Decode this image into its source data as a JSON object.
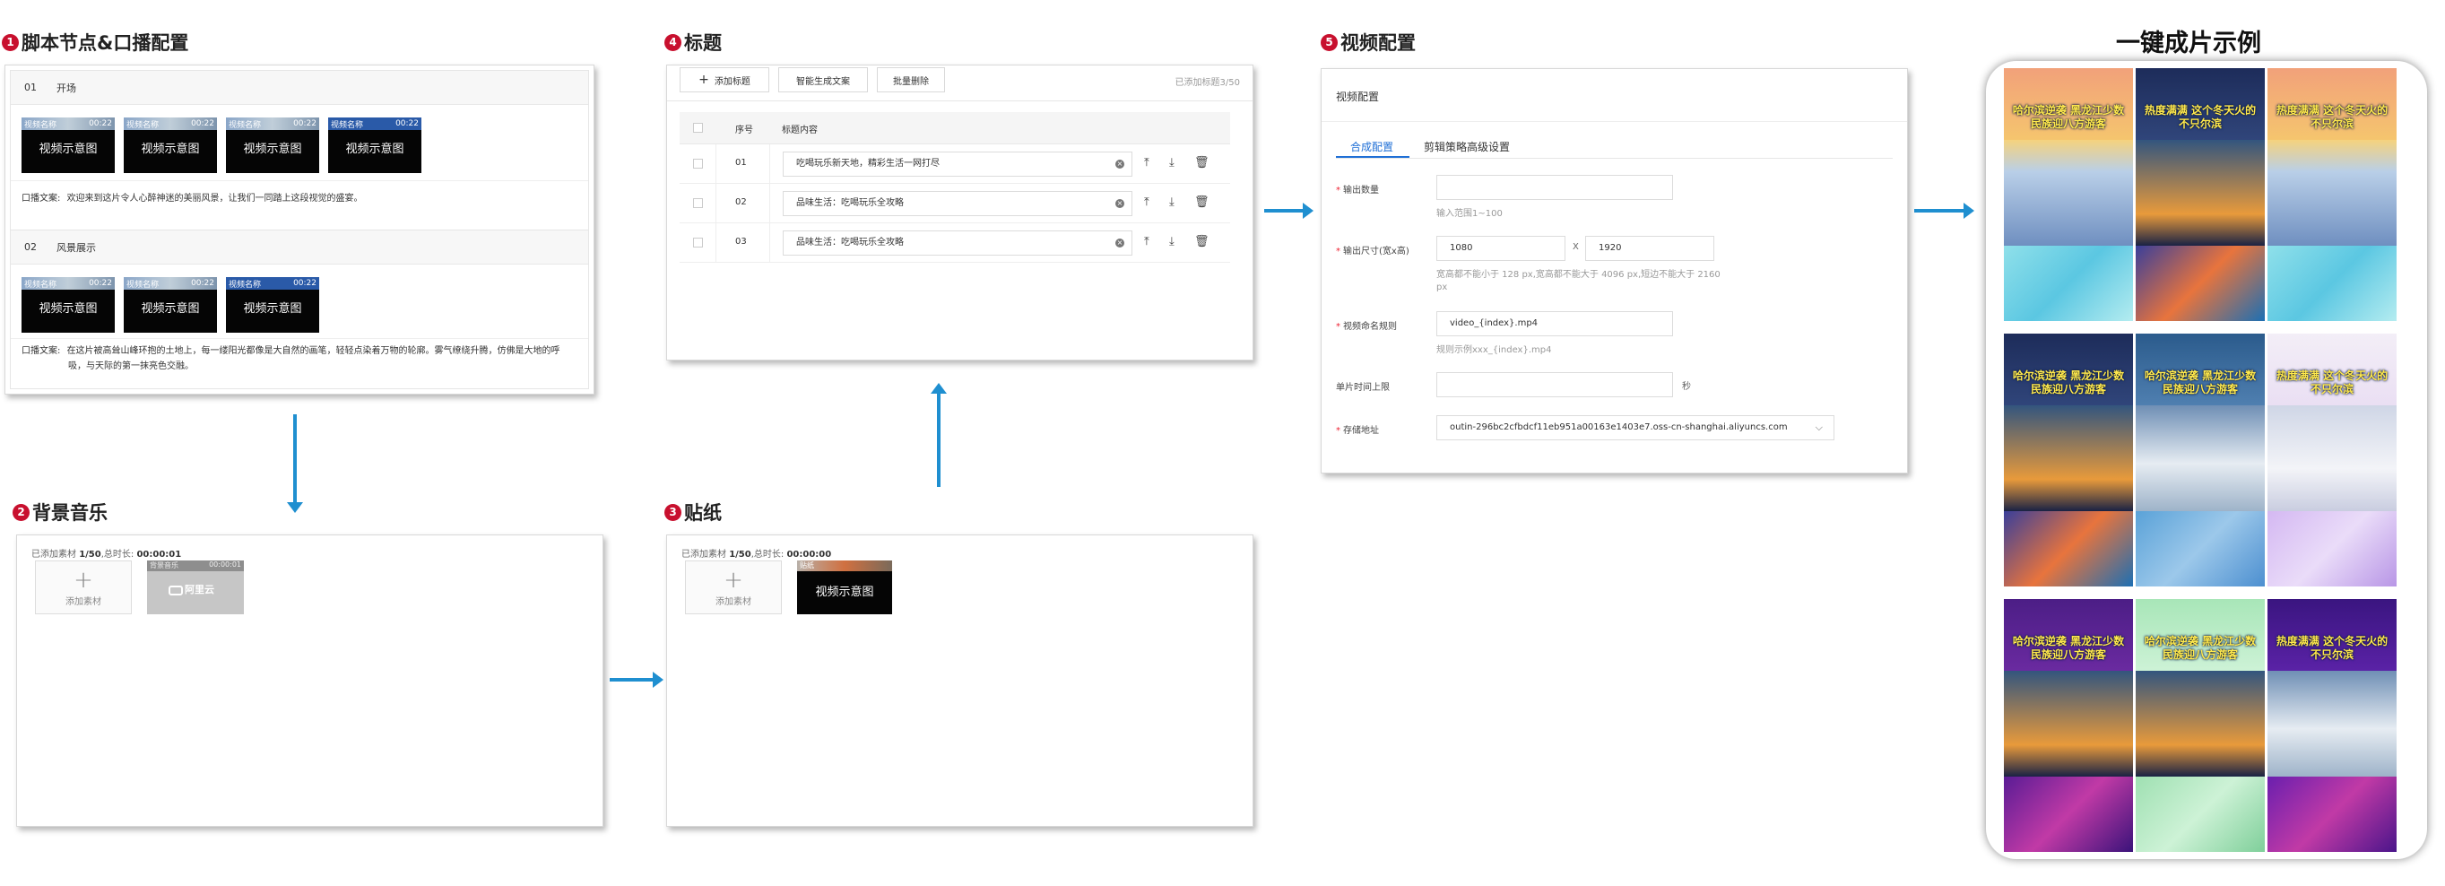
{
  "sections": {
    "s1": {
      "num": "1",
      "title": "脚本节点&口播配置"
    },
    "s2": {
      "num": "2",
      "title": "背景音乐"
    },
    "s3": {
      "num": "3",
      "title": "贴纸"
    },
    "s4": {
      "num": "4",
      "title": "标题"
    },
    "s5": {
      "num": "5",
      "title": "视频配置"
    },
    "example": {
      "title": "一键成片示例"
    }
  },
  "script_nodes": [
    {
      "index": "01",
      "name": "开场",
      "clips": [
        {
          "name": "视频名称",
          "duration": "00:22",
          "label": "视频示意图"
        },
        {
          "name": "视频名称",
          "duration": "00:22",
          "label": "视频示意图"
        },
        {
          "name": "视频名称",
          "duration": "00:22",
          "label": "视频示意图"
        },
        {
          "name": "视频名称",
          "duration": "00:22",
          "label": "视频示意图"
        }
      ],
      "narration_label": "口播文案:",
      "narration": "欢迎来到这片令人心醉神迷的美丽风景，让我们一同踏上这段视觉的盛宴。"
    },
    {
      "index": "02",
      "name": "风景展示",
      "clips": [
        {
          "name": "视频名称",
          "duration": "00:22",
          "label": "视频示意图"
        },
        {
          "name": "视频名称",
          "duration": "00:22",
          "label": "视频示意图"
        },
        {
          "name": "视频名称",
          "duration": "00:22",
          "label": "视频示意图"
        }
      ],
      "narration_label": "口播文案:",
      "narration_line1": "在这片被高耸山峰环抱的土地上，每一缕阳光都像是大自然的画笔，轻轻点染着万物的轮廓。雾气缭绕升腾，仿佛是大地的呼",
      "narration_line2": "吸，与天际的第一抹亮色交融。"
    }
  ],
  "music": {
    "summary_prefix": "已添加素材",
    "summary_count": "1/50",
    "summary_duration_prefix": ",总时长:",
    "summary_duration": "00:00:01",
    "add_label": "添加素材",
    "track_name": "背景音乐",
    "track_duration": "00:00:01",
    "track_label": "阿里云"
  },
  "sticker": {
    "summary_prefix": "已添加素材",
    "summary_count": "1/50",
    "summary_duration_prefix": ",总时长:",
    "summary_duration": "00:00:00",
    "add_label": "添加素材",
    "clip_name": "贴纸",
    "clip_label": "视频示意图"
  },
  "titles": {
    "btn_add": "添加标题",
    "btn_smart": "智能生成文案",
    "btn_delete": "批量删除",
    "count": "已添加标题3/50",
    "col_index": "序号",
    "col_content": "标题内容",
    "rows": [
      {
        "index": "01",
        "text": "吃喝玩乐新天地，精彩生活一网打尽"
      },
      {
        "index": "02",
        "text": "品味生活：吃喝玩乐全攻略"
      },
      {
        "index": "03",
        "text": "品味生活：吃喝玩乐全攻略"
      }
    ]
  },
  "video_config": {
    "header": "视频配置",
    "tabs": [
      "合成配置",
      "剪辑策略高级设置"
    ],
    "output_count_label": "输出数量",
    "output_count_hint": "输入范围1~100",
    "size_label": "输出尺寸(宽x高)",
    "width": "1080",
    "times": "X",
    "height": "1920",
    "size_hint_line1": "宽高都不能小于 128 px,宽高都不能大于 4096 px,短边不能大于 2160",
    "size_hint_line2": "px",
    "naming_label": "视频命名规则",
    "naming_value": "video_{index}.mp4",
    "naming_hint": "规则示例xxx_{index}.mp4",
    "time_limit_label": "单片时间上限",
    "time_limit_unit": "秒",
    "storage_label": "存储地址",
    "storage_value": "outin-296bc2cfbdcf11eb951a00163e1403e7.oss-cn-shanghai.aliyuncs.com"
  },
  "examples": [
    {
      "caption": "哈尔滨逆袭 黑龙江少数民族迎八方游客",
      "theme": "sunset-snow"
    },
    {
      "caption": "热度满满 这个冬天火的不只尔滨",
      "theme": "church-night"
    },
    {
      "caption": "热度满满 这个冬天火的不只尔滨",
      "theme": "sunset-snow"
    },
    {
      "caption": "哈尔滨逆袭 黑龙江少数民族迎八方游客",
      "theme": "church-night"
    },
    {
      "caption": "哈尔滨逆袭 黑龙江少数民族迎八方游客",
      "theme": "cloud-mountain"
    },
    {
      "caption": "热度满满 这个冬天火的不只尔滨",
      "theme": "snow-tree"
    },
    {
      "caption": "哈尔滨逆袭 黑龙江少数民族迎八方游客",
      "theme": "church-night"
    },
    {
      "caption": "哈尔滨逆袭 黑龙江少数民族迎八方游客",
      "theme": "church-night"
    },
    {
      "caption": "热度满满 这个冬天火的不只尔滨",
      "theme": "cloud-mountain"
    }
  ]
}
